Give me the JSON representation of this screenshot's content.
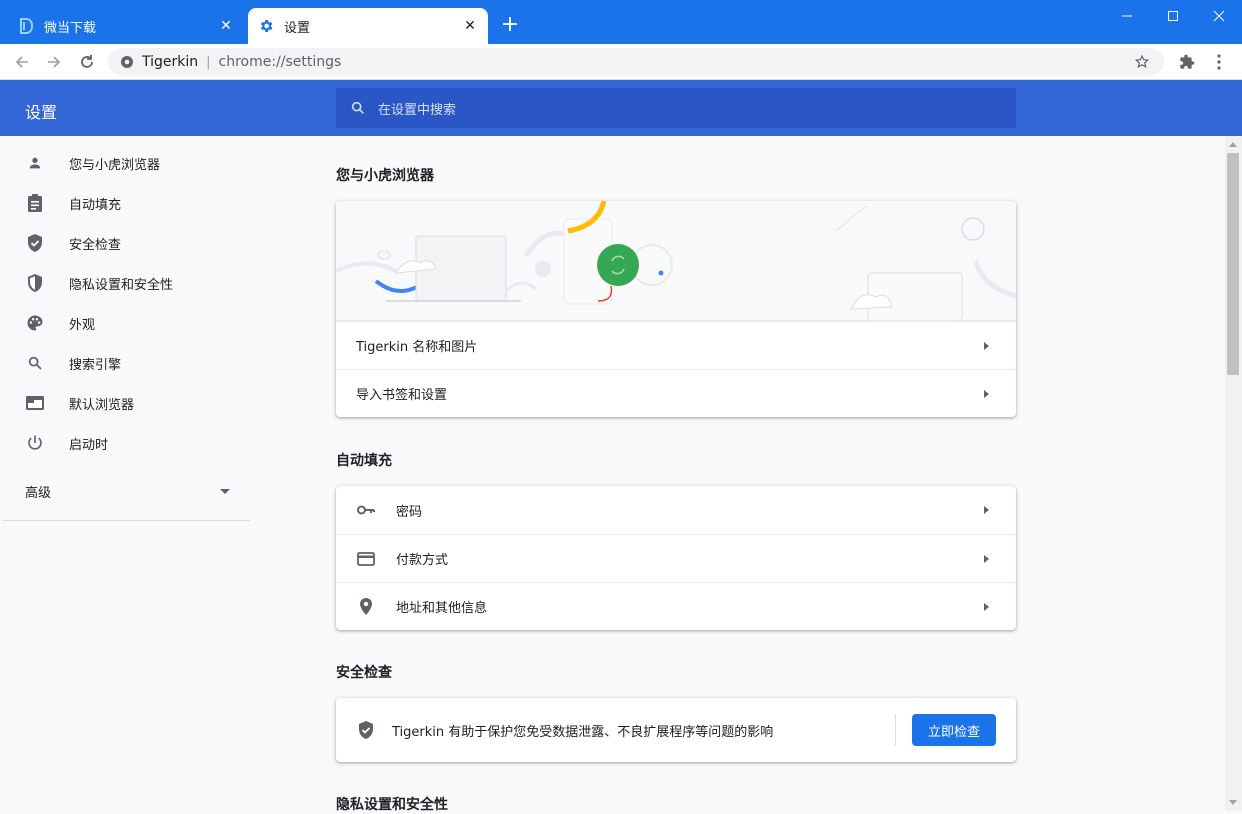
{
  "tabs": [
    {
      "title": "微当下载",
      "active": false
    },
    {
      "title": "设置",
      "active": true
    }
  ],
  "toolbar": {
    "site_name": "Tigerkin",
    "separator": "|",
    "url": "chrome://settings"
  },
  "header": {
    "title": "设置",
    "search_placeholder": "在设置中搜索"
  },
  "sidebar": {
    "items": [
      {
        "label": "您与小虎浏览器",
        "icon": "person-icon"
      },
      {
        "label": "自动填充",
        "icon": "clipboard-icon"
      },
      {
        "label": "安全检查",
        "icon": "shield-check-icon"
      },
      {
        "label": "隐私设置和安全性",
        "icon": "shield-half-icon"
      },
      {
        "label": "外观",
        "icon": "palette-icon"
      },
      {
        "label": "搜索引擎",
        "icon": "search-icon"
      },
      {
        "label": "默认浏览器",
        "icon": "browser-window-icon"
      },
      {
        "label": "启动时",
        "icon": "power-icon"
      }
    ],
    "advanced": "高级"
  },
  "sections": {
    "you": {
      "title": "您与小虎浏览器",
      "rows": [
        "Tigerkin 名称和图片",
        "导入书签和设置"
      ]
    },
    "autofill": {
      "title": "自动填充",
      "rows": [
        "密码",
        "付款方式",
        "地址和其他信息"
      ]
    },
    "safety": {
      "title": "安全检查",
      "text": "Tigerkin 有助于保护您免受数据泄露、不良扩展程序等问题的影响",
      "button": "立即检查"
    },
    "privacy": {
      "title": "隐私设置和安全性"
    }
  },
  "colors": {
    "tab_strip": "#1a73e8",
    "settings_header": "#3367d6",
    "accent": "#1a73e8",
    "sync_green": "#34a853"
  }
}
